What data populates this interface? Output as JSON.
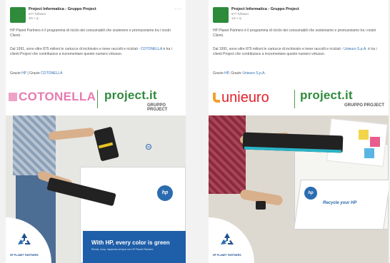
{
  "posts": [
    {
      "author": "Project Informatica - Gruppo Project",
      "followers": "677 follower",
      "time": "3m • ◎",
      "menu": "···",
      "text1": "HP Planet Partners è il programma di riciclo dei consumabili che sostenere e promuoviamo tra i nostri Clienti.",
      "text2_pre": "Dal 1991, sono oltre 875 milioni le cartucce di inchiostro e toner raccolti e riciclati - ",
      "text2_link": "COTONELLA",
      "text2_post": " è tra i clienti Project che contribuisce a incrementare questo numero virtuoso.",
      "text3_pre": "Grazie ",
      "text3_link1": "HP",
      "text3_mid": " | Grazie ",
      "text3_link2": "COTONELLA",
      "brand": "COTONELLA",
      "partner": "project.it",
      "partner_sub": "GRUPPO PROJECT",
      "hp": "hp",
      "slogan": "With HP, every color is green",
      "slogan_sub": "Ricicla, riusa, risparmia sempre con HP Planet Partners",
      "badge_label": "HP PLANET PARTNERS"
    },
    {
      "author": "Project Informatica - Gruppo Project",
      "followers": "677 follower",
      "time": "1m • ◎",
      "menu": "···",
      "text1": "HP Planet Partners è il programma di riciclo dei consumabili che sosteniamo e promuoviamo tra i nostri Clienti.",
      "text2_pre": "Dal 1991, sono oltre 875 milioni le cartucce di inchiostro e toner raccolti e riciclati - ",
      "text2_link": "Unieuro S.p.A.",
      "text2_post": " è tra i clienti Project che contribuisce a incrementare questo numero virtuoso.",
      "text3_pre": "Grazie ",
      "text3_link1": "HP",
      "text3_mid": ", Grazie ",
      "text3_link2": "Unieuro S.p.A.",
      "brand": "unieuro",
      "partner": "project.it",
      "partner_sub": "GRUPPO PROJECT",
      "hp": "hp",
      "envelope_text": "Recycle your HP",
      "badge_label": "HP PLANET PARTNERS"
    }
  ]
}
